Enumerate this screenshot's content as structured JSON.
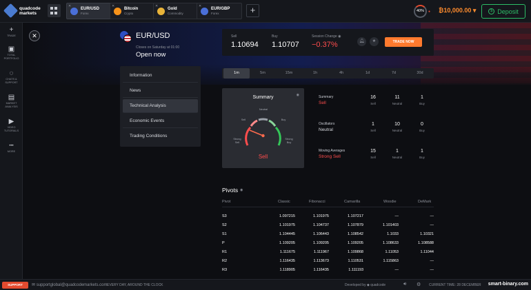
{
  "app": {
    "logo_line1": "quadcode",
    "logo_line2": "markets",
    "percent": "40%",
    "balance": "₿10,000.00 ▾",
    "deposit_label": "Deposit"
  },
  "tabs": [
    {
      "name": "EUR/USD",
      "category": "Forex",
      "icon_color": "#4a6fd8"
    },
    {
      "name": "Bitcoin",
      "category": "Crypto",
      "icon_color": "#f7931a"
    },
    {
      "name": "Gold",
      "category": "Commodity",
      "icon_color": "#e8b339"
    },
    {
      "name": "EUR/GBP",
      "category": "Forex",
      "icon_color": "#4a6fd8"
    }
  ],
  "sidebar": [
    {
      "icon": "plus-icon",
      "glyph": "+",
      "label": "TRADE"
    },
    {
      "icon": "portfolio-icon",
      "glyph": "▣",
      "label": "TOTAL PORTFOLIO"
    },
    {
      "icon": "chat-icon",
      "glyph": "◌",
      "label": "CHATS & SUPPORT"
    },
    {
      "icon": "analysis-icon",
      "glyph": "▤",
      "label": "MARKET ANALYSIS"
    },
    {
      "icon": "video-icon",
      "glyph": "▶",
      "label": "VIDEO TUTORIALS"
    },
    {
      "icon": "more-icon",
      "glyph": "•••",
      "label": "MORE"
    }
  ],
  "instrument": {
    "name": "EUR/USD",
    "closes": "Closes on Saturday at 01:00",
    "status": "Open now"
  },
  "menu": [
    "Information",
    "News",
    "Technical Analysis",
    "Economic Events",
    "Trading Conditions"
  ],
  "prices": {
    "sell_label": "Sell",
    "sell": "1.10694",
    "buy_label": "Buy",
    "buy": "1.10707",
    "change_label": "Session Change",
    "change": "−0.37%",
    "trade_now": "TRADE NOW"
  },
  "timeframes": [
    "1m",
    "5m",
    "15m",
    "1h",
    "4h",
    "1d",
    "7d",
    "30d"
  ],
  "gauge": {
    "title": "Summary",
    "result": "Sell",
    "labels": {
      "neutral": "Neutral",
      "sell": "Sell",
      "buy": "Buy",
      "strong_sell": "Strong Sell",
      "strong_buy": "Strong Buy"
    }
  },
  "summary_rows": [
    {
      "title": "Summary",
      "verdict": "Sell",
      "red": true,
      "sell": "16",
      "neutral": "11",
      "buy": "1"
    },
    {
      "title": "Oscillators",
      "verdict": "Neutral",
      "red": false,
      "sell": "1",
      "neutral": "10",
      "buy": "0"
    },
    {
      "title": "Moving Averages",
      "verdict": "Strong Sell",
      "red": true,
      "sell": "15",
      "neutral": "1",
      "buy": "1"
    }
  ],
  "count_labels": {
    "sell": "Sell",
    "neutral": "Neutral",
    "buy": "Buy"
  },
  "pivots": {
    "title": "Pivots",
    "headers": [
      "Pivot",
      "Classic",
      "Fibonacci",
      "Camarilla",
      "Woodie",
      "DeMark"
    ],
    "rows": [
      [
        "S3",
        "1.097215",
        "1.101975",
        "1.107217",
        "—",
        "—"
      ],
      [
        "S2",
        "1.101975",
        "1.104737",
        "1.107879",
        "1.101403",
        "—"
      ],
      [
        "S1",
        "1.104445",
        "1.106443",
        "1.108542",
        "1.1033",
        "1.10321"
      ],
      [
        "P",
        "1.109205",
        "1.109205",
        "1.109205",
        "1.108633",
        "1.108588"
      ],
      [
        "R1",
        "1.111675",
        "1.111967",
        "1.109868",
        "1.11053",
        "1.11044"
      ],
      [
        "R2",
        "1.116435",
        "1.113673",
        "1.110531",
        "1.115863",
        "—"
      ],
      [
        "R3",
        "1.118905",
        "1.116435",
        "1.111193",
        "—",
        "—"
      ]
    ]
  },
  "footer": {
    "support": "SUPPORT",
    "email": "supportglobal@quadcodemarkets.com",
    "tagline": "EVERY DAY, AROUND THE CLOCK",
    "developed_by": "Developed by ◆ quadcode",
    "current_time": "CURRENT TIME: 28 DECEMBER",
    "watermark": "smart-binary.com"
  }
}
